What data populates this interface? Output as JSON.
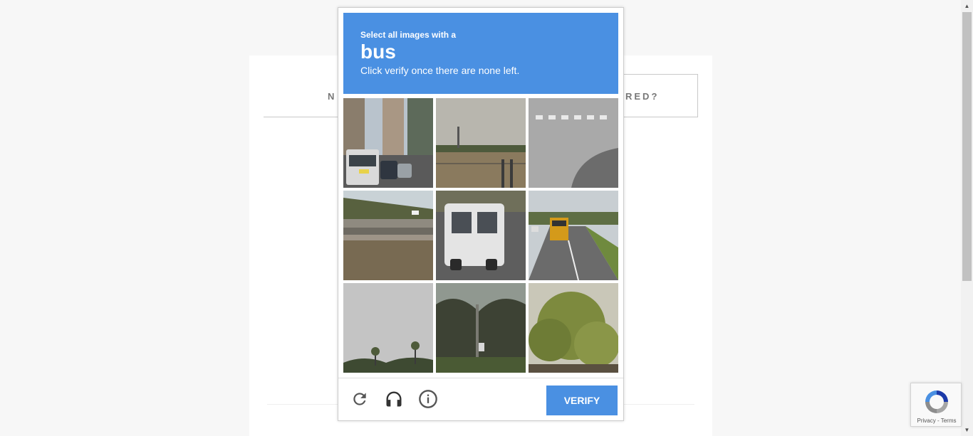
{
  "background": {
    "tab_left": "N",
    "tab_right": "RED?"
  },
  "captcha": {
    "instruction_small": "Select all images with a",
    "target_object": "bus",
    "instruction_sub": "Click verify once there are none left.",
    "tiles": [
      {
        "label": "street-with-bus"
      },
      {
        "label": "field-with-fence"
      },
      {
        "label": "road-crosswalk"
      },
      {
        "label": "highway-bridge"
      },
      {
        "label": "white-bus-rear"
      },
      {
        "label": "road-with-school-bus"
      },
      {
        "label": "sky-with-palm-trees"
      },
      {
        "label": "trees-and-pole"
      },
      {
        "label": "tree-foliage"
      }
    ],
    "footer": {
      "reload_icon": "reload-icon",
      "audio_icon": "headphones-icon",
      "info_icon": "info-icon",
      "verify_label": "VERIFY"
    },
    "colors": {
      "accent": "#4a90e2"
    }
  },
  "badge": {
    "text": "Privacy - Terms"
  }
}
